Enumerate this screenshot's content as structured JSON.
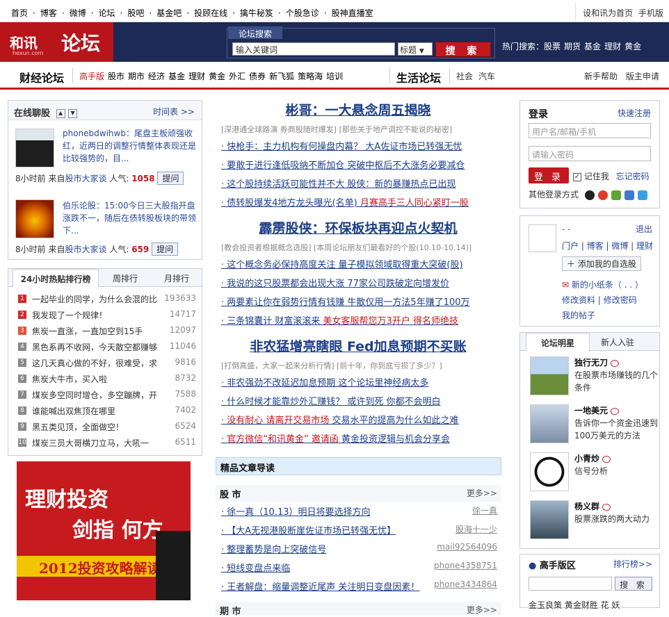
{
  "topnav": {
    "links": [
      "首页",
      "博客",
      "微博",
      "论坛",
      "股吧",
      "基金吧",
      "投顾在线",
      "擒牛秘笈",
      "个股急诊",
      "股神直播室"
    ],
    "set_home": "设和讯为首页",
    "mobile": "手机版"
  },
  "header": {
    "brand": "和讯",
    "brand_sub": "hexun.com",
    "forum": "论坛",
    "search_tab": "论坛搜索",
    "search_placeholder": "输入关键词",
    "search_select": "标题",
    "search_button": "搜 索",
    "hot_label": "热门搜索：",
    "hot_items": [
      "股票",
      "期货",
      "基金",
      "理财",
      "黄金"
    ]
  },
  "subnav": {
    "finance_title": "财经论坛",
    "finance_items": [
      "高手版",
      "股市",
      "期市",
      "经济",
      "基金",
      "理财",
      "黄金",
      "外汇",
      "债券",
      "新飞狐",
      "策略海",
      "培训"
    ],
    "life_title": "生活论坛",
    "life_items": [
      "社会",
      "汽车"
    ],
    "help": "新手帮助",
    "apply": "版主申请"
  },
  "chat": {
    "title": "在线聊股",
    "more": "时间表 >>",
    "posts": [
      {
        "text": "phonebdwihwb：尾盘主板顽强收红，近两日的调整行情整体表现还是比较强势的，目...",
        "time": "8小时前",
        "from": "来自",
        "board": "股市大家谈",
        "pop_label": "人气:",
        "pop": "1058",
        "ask": "提问"
      },
      {
        "text": "伯乐论股：15:00今日三大股指开盘涨跌不一，随后在债转股板块的带领下...",
        "time": "8小时前",
        "from": "来自",
        "board": "股市大家谈",
        "pop_label": "人气:",
        "pop": "659",
        "ask": "提问"
      }
    ]
  },
  "rank": {
    "tabs": [
      "24小时热贴排行榜",
      "周排行",
      "月排行"
    ],
    "items": [
      {
        "n": "1",
        "t": "一起毕业的同学，为什么会混的比",
        "c": "193633"
      },
      {
        "n": "2",
        "t": "我发现了一个规律！",
        "c": "14717"
      },
      {
        "n": "3",
        "t": "焦炭一直涨，一直加空到15手",
        "c": "12097"
      },
      {
        "n": "4",
        "t": "黑色系再不收网，今天散空都赚够",
        "c": "11046"
      },
      {
        "n": "5",
        "t": "这几天真心做的不好，很难受，求",
        "c": "9816"
      },
      {
        "n": "6",
        "t": "焦炭大牛市，买入啦",
        "c": "8732"
      },
      {
        "n": "7",
        "t": "煤炭多空同时增仓，多空蹦牌，开",
        "c": "7588"
      },
      {
        "n": "8",
        "t": "谁能喊出双焦顶在哪里",
        "c": "7402"
      },
      {
        "n": "9",
        "t": "黑五类见顶，全面做空！",
        "c": "6524"
      },
      {
        "n": "10",
        "t": "煤炭三员大哥横刀立马，大吼一",
        "c": "6511"
      }
    ]
  },
  "ad": {
    "l1": "理财投资",
    "l2": "剑指 何方",
    "l3": "2012投资攻略解读"
  },
  "center": {
    "blocks": [
      {
        "headline": "彬哥：一大悬念周五揭晓",
        "sub": "[深港通全球路演 券商股随时爆发] [那些关于地产调控不能说的秘密]",
        "lines": [
          [
            {
              "t": "快枪手：主力机构有何操盘内幕？",
              "r": false
            },
            {
              "t": "大A佐证市场已转强无忧",
              "r": false
            }
          ],
          [
            {
              "t": "要敢于进行逢低吸纳不断加仓",
              "r": false
            },
            {
              "t": "突破中枢后不大涨务必要减仓",
              "r": false
            }
          ],
          [
            {
              "t": "这个股持续活跃可能性并不大",
              "r": false
            },
            {
              "t": "股侠：新的暴赚热点已出现",
              "r": false
            }
          ],
          [
            {
              "t": "债转股爆发4地方龙头曝光(名单)",
              "r": false
            },
            {
              "t": "月赛高手三人同心紧盯一股",
              "r": true
            }
          ]
        ]
      },
      {
        "headline": "霹雳股侠：环保板块再迎点火契机",
        "sub": "[教会投资者根据概念选股] [本周论坛朋友们最看好的个股(10.10-10.14)]",
        "lines": [
          [
            {
              "t": "这个概念务必保持高度关注",
              "r": false
            },
            {
              "t": "量子模拟领域取得重大突破(股)",
              "r": false
            }
          ],
          [
            {
              "t": "我说的这只股票都会出现大涨",
              "r": false
            },
            {
              "t": "77家公司跌破定向增发价",
              "r": false
            }
          ],
          [
            {
              "t": "两要素让你在弱势行情有钱赚",
              "r": false
            },
            {
              "t": "牛散仅用一方法5年赚了100万",
              "r": false
            }
          ],
          [
            {
              "t": "三条锦囊计 财富滚滚来",
              "r": false
            },
            {
              "t": "美女客服帮您万3开户 得名师绝技",
              "r": true
            }
          ]
        ]
      },
      {
        "headline": "非农猛增亮瞎眼 Fed加息预期不买账",
        "sub": "[打倒高盛，大家一起来分析行情] [前十年，你到底亏损了多少？]",
        "lines": [
          [
            {
              "t": "非农强劲不改延迟加息预期",
              "r": false
            },
            {
              "t": "这个论坛里神经病太多",
              "r": false
            }
          ],
          [
            {
              "t": "什么时候才能靠炒外汇赚钱？",
              "r": false
            },
            {
              "t": "或许到死 你都不会明白",
              "r": false
            }
          ],
          [
            {
              "t": "没有耐心 请离开交易市场",
              "r": true
            },
            {
              "t": "交易水平的提高为什么如此之难",
              "r": false
            }
          ],
          [
            {
              "t": "官方微信“和讯黄金”",
              "r": true
            },
            {
              "t": "邀请函",
              "r": true
            },
            {
              "t": "黄金投资逻辑与机会分享会",
              "r": false
            }
          ]
        ]
      }
    ],
    "featured": "精品文章导读",
    "section": "股 市",
    "section_more": "更多>>",
    "articles": [
      {
        "t": "徐一真（10.13）明日将要选择方向",
        "u": "徐一真"
      },
      {
        "t": "【大A无视港股断崖佐证市场已转强无忧】",
        "u": "股海十一少"
      },
      {
        "t": "整理蓄势是向上突破信号",
        "u": "mail92564096"
      },
      {
        "t": "短线变盘点来临",
        "u": "phone4358751"
      },
      {
        "t": "王者解盘：缩量调整近尾声 关注明日变盘因素！",
        "u": "phone3434864"
      }
    ],
    "section2": "期 市",
    "section2_more": "更多>>"
  },
  "login": {
    "title": "登录",
    "register": "快速注册",
    "user_placeholder": "用户名/邮箱/手机",
    "pwd_placeholder": "请输入密码",
    "button": "登 录",
    "remember": "记住我",
    "forgot": "忘记密码",
    "other": "其他登录方式"
  },
  "user": {
    "name": "- -",
    "logout": "退出",
    "links": "门户 | 博客 | 微博 | 理财",
    "add": "添加我的自选股",
    "note": "新的小纸条（ . . ）",
    "edit": "修改资料",
    "pwd": "修改密码",
    "posts": "我的帖子"
  },
  "stars": {
    "tabs": [
      "论坛明星",
      "新人入驻"
    ],
    "items": [
      {
        "name": "独行无刀",
        "desc": "在股票市场赚钱的几个条件"
      },
      {
        "name": "一地美元",
        "desc": "告诉你一个资金迅速到100万美元的方法"
      },
      {
        "name": "小青炒",
        "desc": "信号分析"
      },
      {
        "name": "杨义群",
        "desc": "股票涨跌的两大动力"
      }
    ]
  },
  "master": {
    "title": "高手版区",
    "rank": "排行榜>>",
    "button": "搜 索",
    "list": "金玉良策   黄金财胜    花 妖"
  },
  "colors": {
    "brand_red": "#c3181f",
    "header_navy": "#1d2a55",
    "link_blue": "#1d3f8a"
  }
}
